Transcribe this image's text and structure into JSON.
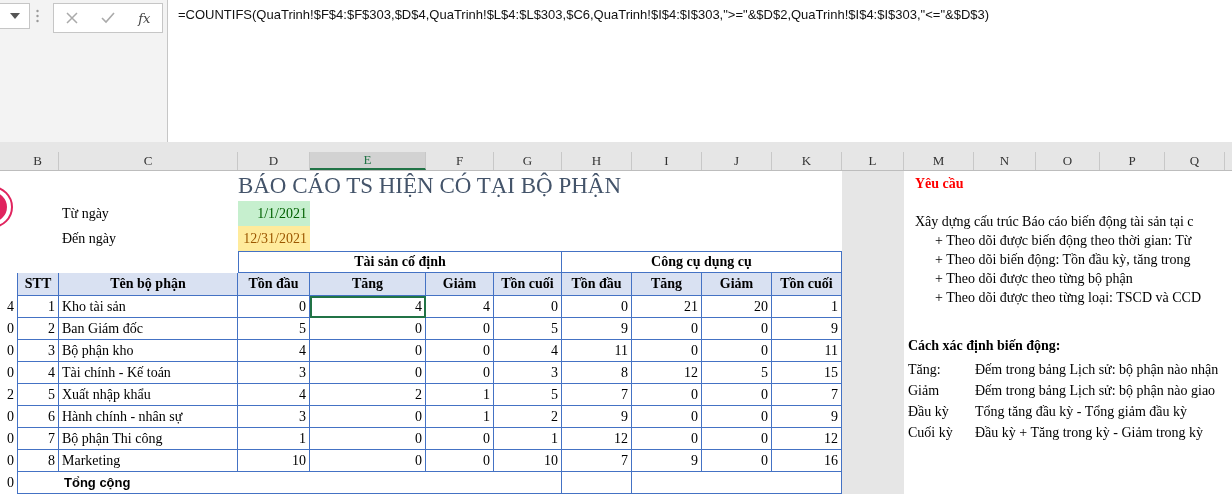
{
  "formula_bar": {
    "function_label": "fx",
    "formula": "=COUNTIFS(QuaTrinh!$F$4:$F$303,$D$4,QuaTrinh!$L$4:$L$303,$C6,QuaTrinh!$I$4:$I$303,\">=\"&$D$2,QuaTrinh!$I$4:$I$303,\"<=\"&$D$3)"
  },
  "columns": [
    {
      "label": "B",
      "selected": false
    },
    {
      "label": "C",
      "selected": false
    },
    {
      "label": "D",
      "selected": false
    },
    {
      "label": "E",
      "selected": true
    },
    {
      "label": "F",
      "selected": false
    },
    {
      "label": "G",
      "selected": false
    },
    {
      "label": "H",
      "selected": false
    },
    {
      "label": "I",
      "selected": false
    },
    {
      "label": "J",
      "selected": false
    },
    {
      "label": "K",
      "selected": false
    },
    {
      "label": "L",
      "selected": false
    },
    {
      "label": "M",
      "selected": false
    },
    {
      "label": "N",
      "selected": false
    },
    {
      "label": "O",
      "selected": false
    },
    {
      "label": "P",
      "selected": false
    },
    {
      "label": "Q",
      "selected": false
    }
  ],
  "report": {
    "title": "BÁO CÁO TS HIỆN CÓ TẠI BỘ PHẬN",
    "from_label": "Từ ngày",
    "from_value": "1/1/2021",
    "to_label": "Đến ngày",
    "to_value": "12/31/2021",
    "groups": [
      "Tài sản cố định",
      "Công cụ dụng cụ"
    ],
    "headers": [
      "STT",
      "Tên bộ phận",
      "Tồn đầu",
      "Tăng",
      "Giảm",
      "Tồn cuối",
      "Tồn đầu",
      "Tăng",
      "Giảm",
      "Tồn cuối"
    ],
    "rows": [
      {
        "column_a": "4",
        "stt": "1",
        "name": "Kho tài sản",
        "values": [
          "0",
          "4",
          "4",
          "0",
          "0",
          "21",
          "20",
          "1"
        ],
        "selected": true
      },
      {
        "column_a": "0",
        "stt": "2",
        "name": "Ban Giám đốc",
        "values": [
          "5",
          "0",
          "0",
          "5",
          "9",
          "0",
          "0",
          "9"
        ],
        "selected": false
      },
      {
        "column_a": "0",
        "stt": "3",
        "name": "Bộ phận kho",
        "values": [
          "4",
          "0",
          "0",
          "4",
          "11",
          "0",
          "0",
          "11"
        ],
        "selected": false
      },
      {
        "column_a": "0",
        "stt": "4",
        "name": "Tài chính - Kế toán",
        "values": [
          "3",
          "0",
          "0",
          "3",
          "8",
          "12",
          "5",
          "15"
        ],
        "selected": false
      },
      {
        "column_a": "2",
        "stt": "5",
        "name": "Xuất nhập khẩu",
        "values": [
          "4",
          "2",
          "1",
          "5",
          "7",
          "0",
          "0",
          "7"
        ],
        "selected": false
      },
      {
        "column_a": "0",
        "stt": "6",
        "name": "Hành chính - nhân sự",
        "values": [
          "3",
          "0",
          "1",
          "2",
          "9",
          "0",
          "0",
          "9"
        ],
        "selected": false
      },
      {
        "column_a": "0",
        "stt": "7",
        "name": "Bộ phận Thi công",
        "values": [
          "1",
          "0",
          "0",
          "1",
          "12",
          "0",
          "0",
          "12"
        ],
        "selected": false
      },
      {
        "column_a": "0",
        "stt": "8",
        "name": "Marketing",
        "values": [
          "10",
          "0",
          "0",
          "10",
          "7",
          "9",
          "0",
          "16"
        ],
        "selected": false
      }
    ],
    "total_column_a": "0",
    "total_label": "Tổng cộng"
  },
  "notes": {
    "heading": "Yêu cầu",
    "intro": "Xây dựng cấu trúc Báo cáo biến động tài sản tại c",
    "bullets": [
      "+ Theo dõi được biến động theo thời gian: Từ",
      "+ Theo dõi biến động: Tồn đầu kỳ, tăng trong",
      "+ Theo dõi được theo từng bộ phận",
      "+ Theo dõi được theo từng loại: TSCD và CCD"
    ],
    "method_heading": "Cách xác định biến động:",
    "methods": [
      {
        "term": "Tăng:",
        "text": "Đếm trong bảng Lịch sử: bộ phận nào nhận"
      },
      {
        "term": "Giảm",
        "text": "Đếm trong bảng Lịch sử: bộ phận nào giao"
      },
      {
        "term": "Đầu kỳ",
        "text": "Tổng tăng đầu kỳ - Tổng giảm đầu kỳ"
      },
      {
        "term": "Cuối kỳ",
        "text": "Đầu kỳ + Tăng trong kỳ - Giảm trong kỳ"
      }
    ]
  }
}
